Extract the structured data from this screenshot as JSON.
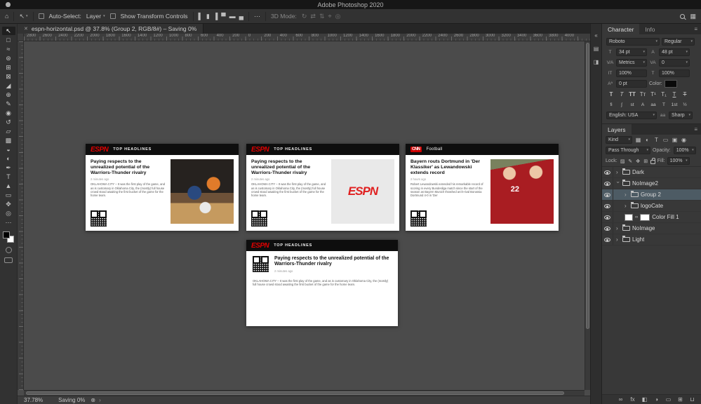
{
  "menu_bar": {
    "title": "Adobe Photoshop 2020"
  },
  "options_bar": {
    "auto_select_label": "Auto-Select:",
    "auto_select_value": "Layer",
    "show_transform_label": "Show Transform Controls",
    "mode_label": "3D Mode:",
    "align_icons": [
      {
        "name": "align-left-edges-icon",
        "glyph": "▌"
      },
      {
        "name": "align-horizontal-centers-icon",
        "glyph": "▮"
      },
      {
        "name": "align-right-edges-icon",
        "glyph": "▐"
      },
      {
        "name": "align-top-edges-icon",
        "glyph": "▀"
      },
      {
        "name": "align-vertical-centers-icon",
        "glyph": "▬"
      },
      {
        "name": "align-bottom-edges-icon",
        "glyph": "▄"
      }
    ],
    "mode_icons": [
      {
        "name": "3d-rotate-icon",
        "glyph": "↻"
      },
      {
        "name": "3d-roll-icon",
        "glyph": "⇄"
      },
      {
        "name": "3d-drag-icon",
        "glyph": "⇅"
      },
      {
        "name": "3d-slide-icon",
        "glyph": "⌖"
      },
      {
        "name": "3d-scale-icon",
        "glyph": "◎"
      }
    ]
  },
  "tab": {
    "title": "espn-horizontal.psd @ 37.8% (Group 2, RGB/8#) – Saving 0%"
  },
  "ruler": {
    "numbers": [
      "2800",
      "2600",
      "2400",
      "2200",
      "2000",
      "1800",
      "1600",
      "1400",
      "1200",
      "1000",
      "800",
      "600",
      "400",
      "200",
      "0",
      "200",
      "400",
      "600",
      "800",
      "1000",
      "1200",
      "1400",
      "1600",
      "1800",
      "2000",
      "2200",
      "2400",
      "2600",
      "2800",
      "3000",
      "3200",
      "3400",
      "3600",
      "3800",
      "4000"
    ]
  },
  "tools": [
    {
      "name": "move-tool",
      "glyph": "↖",
      "cls": "active"
    },
    {
      "name": "rectangular-marquee-tool",
      "glyph": "□"
    },
    {
      "name": "lasso-tool",
      "glyph": "≈"
    },
    {
      "name": "quick-selection-tool",
      "glyph": "⊛"
    },
    {
      "name": "crop-tool",
      "glyph": "⊞"
    },
    {
      "name": "frame-tool",
      "glyph": "⊠"
    },
    {
      "name": "eyedropper-tool",
      "glyph": "◢"
    },
    {
      "name": "spot-healing-brush-tool",
      "glyph": "⊕"
    },
    {
      "name": "brush-tool",
      "glyph": "✎"
    },
    {
      "name": "clone-stamp-tool",
      "glyph": "◉"
    },
    {
      "name": "history-brush-tool",
      "glyph": "↺"
    },
    {
      "name": "eraser-tool",
      "glyph": "▱"
    },
    {
      "name": "gradient-tool",
      "glyph": "▩"
    },
    {
      "name": "blur-tool",
      "glyph": "◒"
    },
    {
      "name": "dodge-tool",
      "glyph": "◐"
    },
    {
      "name": "pen-tool",
      "glyph": "✒"
    },
    {
      "name": "type-tool",
      "glyph": "T"
    },
    {
      "name": "path-selection-tool",
      "glyph": "▲"
    },
    {
      "name": "shape-tool",
      "glyph": "▭"
    },
    {
      "name": "hand-tool",
      "glyph": "✥"
    },
    {
      "name": "zoom-tool",
      "glyph": "◎"
    },
    {
      "name": "edit-toolbar-icon",
      "glyph": "⋯"
    }
  ],
  "dock_icons": [
    {
      "name": "expand-panels-icon",
      "glyph": "«"
    },
    {
      "name": "history-panel-icon",
      "glyph": "▤"
    },
    {
      "name": "properties-panel-icon",
      "glyph": "◨"
    }
  ],
  "character_panel": {
    "tab_character": "Character",
    "tab_info": "Info",
    "font_family": "Roboto",
    "font_style": "Regular",
    "font_size_icon": "T",
    "font_size": "34 pt",
    "leading_icon": "A",
    "leading": "48 pt",
    "kerning_icon": "V∕A",
    "kerning": "Metrics",
    "tracking_icon": "VA",
    "tracking": "0",
    "vertical_scale_icon": "ΙT",
    "vertical_scale": "100%",
    "horizontal_scale_icon": "T",
    "horizontal_scale": "100%",
    "baseline_icon": "Aª",
    "baseline_shift": "0 pt",
    "color_label": "Color:",
    "language": "English: USA",
    "anti_alias_icon": "aa",
    "anti_alias": "Sharp",
    "style_buttons": [
      {
        "name": "faux-bold-icon",
        "glyph": "T",
        "cls": "b"
      },
      {
        "name": "faux-italic-icon",
        "glyph": "T",
        "cls": "i"
      },
      {
        "name": "all-caps-icon",
        "glyph": "TT",
        "cls": "b"
      },
      {
        "name": "small-caps-icon",
        "glyph": "Tᴛ"
      },
      {
        "name": "superscript-icon",
        "glyph": "T¹"
      },
      {
        "name": "subscript-icon",
        "glyph": "T₁"
      },
      {
        "name": "underline-icon",
        "glyph": "T",
        "cls": "u"
      },
      {
        "name": "strikethrough-icon",
        "glyph": "T",
        "cls": "s"
      }
    ],
    "opentype_buttons": [
      {
        "name": "ligatures-icon",
        "glyph": "fi"
      },
      {
        "name": "contextual-alternates-icon",
        "glyph": "ʃ"
      },
      {
        "name": "discretionary-ligatures-icon",
        "glyph": "st"
      },
      {
        "name": "stylistic-alternates-icon",
        "glyph": "A"
      },
      {
        "name": "titling-alternates-icon",
        "glyph": "aa"
      },
      {
        "name": "swash-icon",
        "glyph": "T"
      },
      {
        "name": "ordinals-icon",
        "glyph": "1st"
      },
      {
        "name": "fractions-icon",
        "glyph": "½"
      }
    ]
  },
  "layers_panel": {
    "title": "Layers",
    "kind": "Kind",
    "filter_icons": [
      {
        "name": "filter-pixel-layers-icon",
        "glyph": "▦"
      },
      {
        "name": "filter-adjustment-layers-icon",
        "glyph": "◐"
      },
      {
        "name": "filter-type-layers-icon",
        "glyph": "T"
      },
      {
        "name": "filter-shape-layers-icon",
        "glyph": "▭"
      },
      {
        "name": "filter-smart-objects-icon",
        "glyph": "▣"
      },
      {
        "name": "layer-filtering-toggle-icon",
        "glyph": "◉"
      }
    ],
    "blend_mode": "Pass Through",
    "opacity_label": "Opacity:",
    "opacity": "100%",
    "lock_label": "Lock:",
    "lock_icons": [
      {
        "name": "lock-transparent-pixels-icon",
        "glyph": "▨"
      },
      {
        "name": "lock-image-pixels-icon",
        "glyph": "✎"
      },
      {
        "name": "lock-position-icon",
        "glyph": "✥"
      },
      {
        "name": "lock-artboard-icon",
        "glyph": "⊞"
      },
      {
        "name": "lock-all-icon",
        "cls": "padlock"
      }
    ],
    "fill_label": "Fill:",
    "fill": "100%",
    "layers": [
      {
        "name": "Dark",
        "type": "group",
        "indent": 0,
        "expanded": false
      },
      {
        "name": "NoImage2",
        "type": "group",
        "indent": 0,
        "expanded": true
      },
      {
        "name": "Group 2",
        "type": "group",
        "indent": 1,
        "expanded": false,
        "selected": true
      },
      {
        "name": "logoCate",
        "type": "group",
        "indent": 1,
        "expanded": false
      },
      {
        "name": "Color Fill 1",
        "type": "fill",
        "indent": 1
      },
      {
        "name": "NoImage",
        "type": "group",
        "indent": 0,
        "expanded": false
      },
      {
        "name": "Light",
        "type": "group",
        "indent": 0,
        "expanded": false
      }
    ],
    "bottom_icons": [
      {
        "name": "link-layers-icon",
        "glyph": "∞"
      },
      {
        "name": "layer-effects-icon",
        "glyph": "fx"
      },
      {
        "name": "add-layer-mask-icon",
        "glyph": "◧"
      },
      {
        "name": "add-adjustment-layer-icon",
        "glyph": "◑"
      },
      {
        "name": "new-group-icon",
        "glyph": "▭"
      },
      {
        "name": "new-layer-icon",
        "glyph": "⊞"
      },
      {
        "name": "delete-layer-icon",
        "glyph": "⊔"
      }
    ]
  },
  "stories": {
    "espn": {
      "brand": "ESPN",
      "category": "TOP HEADLINES",
      "headline": "Paying respects to the unrealized potential of the Warriors-Thunder rivalry",
      "timestamp": "2 minutes ago",
      "body": "OKLAHOMA CITY – It was the first play of the game, and as is customary in Oklahoma City, the (mostly) full house crowd stood awaiting the first bucket of the game for the home team."
    },
    "cnn": {
      "brand": "CNN",
      "category": "Football",
      "headline": "Bayern routs Dortmund in 'Der Klassiker' as Lewandowski extends record",
      "timestamp": "2 hours ago",
      "body": "Robert Lewandowski extended his remarkable record of scoring in every Bundesliga match since the start of the season as Bayern Munich thrashed arch-rival Borussia Dortmund 4-0 in 'Der",
      "photo_number": "22"
    }
  },
  "status_bar": {
    "zoom": "37.78%",
    "status": "Saving 0%"
  },
  "colors": {
    "espn_red": "#e00000",
    "cnn_red": "#cc0000",
    "selected_layer": "#4d5b64"
  }
}
